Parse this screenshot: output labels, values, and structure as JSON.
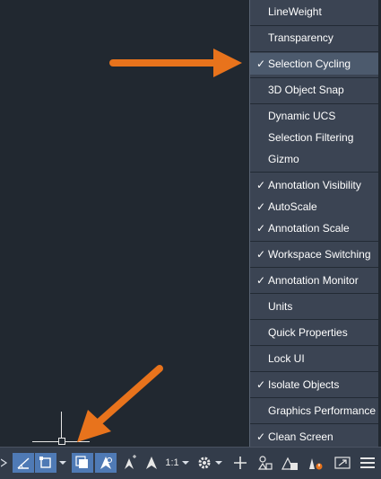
{
  "menu": {
    "items": [
      {
        "label": "LineWeight",
        "checked": false
      },
      {
        "label": "Transparency",
        "checked": false
      },
      {
        "label": "Selection Cycling",
        "checked": true
      },
      {
        "label": "3D Object Snap",
        "checked": false
      },
      {
        "label": "Dynamic UCS",
        "checked": false
      },
      {
        "label": "Selection Filtering",
        "checked": false
      },
      {
        "label": "Gizmo",
        "checked": false
      },
      {
        "label": "Annotation Visibility",
        "checked": true
      },
      {
        "label": "AutoScale",
        "checked": true
      },
      {
        "label": "Annotation Scale",
        "checked": true
      },
      {
        "label": "Workspace Switching",
        "checked": true
      },
      {
        "label": "Annotation Monitor",
        "checked": true
      },
      {
        "label": "Units",
        "checked": false
      },
      {
        "label": "Quick Properties",
        "checked": false
      },
      {
        "label": "Lock UI",
        "checked": false
      },
      {
        "label": "Isolate Objects",
        "checked": true
      },
      {
        "label": "Graphics Performance",
        "checked": false
      },
      {
        "label": "Clean Screen",
        "checked": true
      }
    ],
    "check_glyph": "✓"
  },
  "statusbar": {
    "annotation_scale": "1:1",
    "icons": [
      "isodraft-icon",
      "ortho-icon",
      "object-snap-icon",
      "dropdown-icon",
      "selection-cycling-icon",
      "annotation-visibility-icon",
      "autoscale-icon",
      "annotation-scale-icon",
      "scale-dropdown-icon",
      "workspace-gear-icon",
      "dropdown-icon",
      "annotation-monitor-plus-icon",
      "units-icon",
      "quick-properties-icon",
      "lock-ui-icon",
      "isolate-objects-icon",
      "clean-screen-icon",
      "customization-menu-icon"
    ]
  },
  "colors": {
    "canvas": "#212830",
    "menu_bg": "#3b4453",
    "statusbar_bg": "#333c4a",
    "active_button": "#4f7ab5",
    "arrow": "#e8731c"
  }
}
